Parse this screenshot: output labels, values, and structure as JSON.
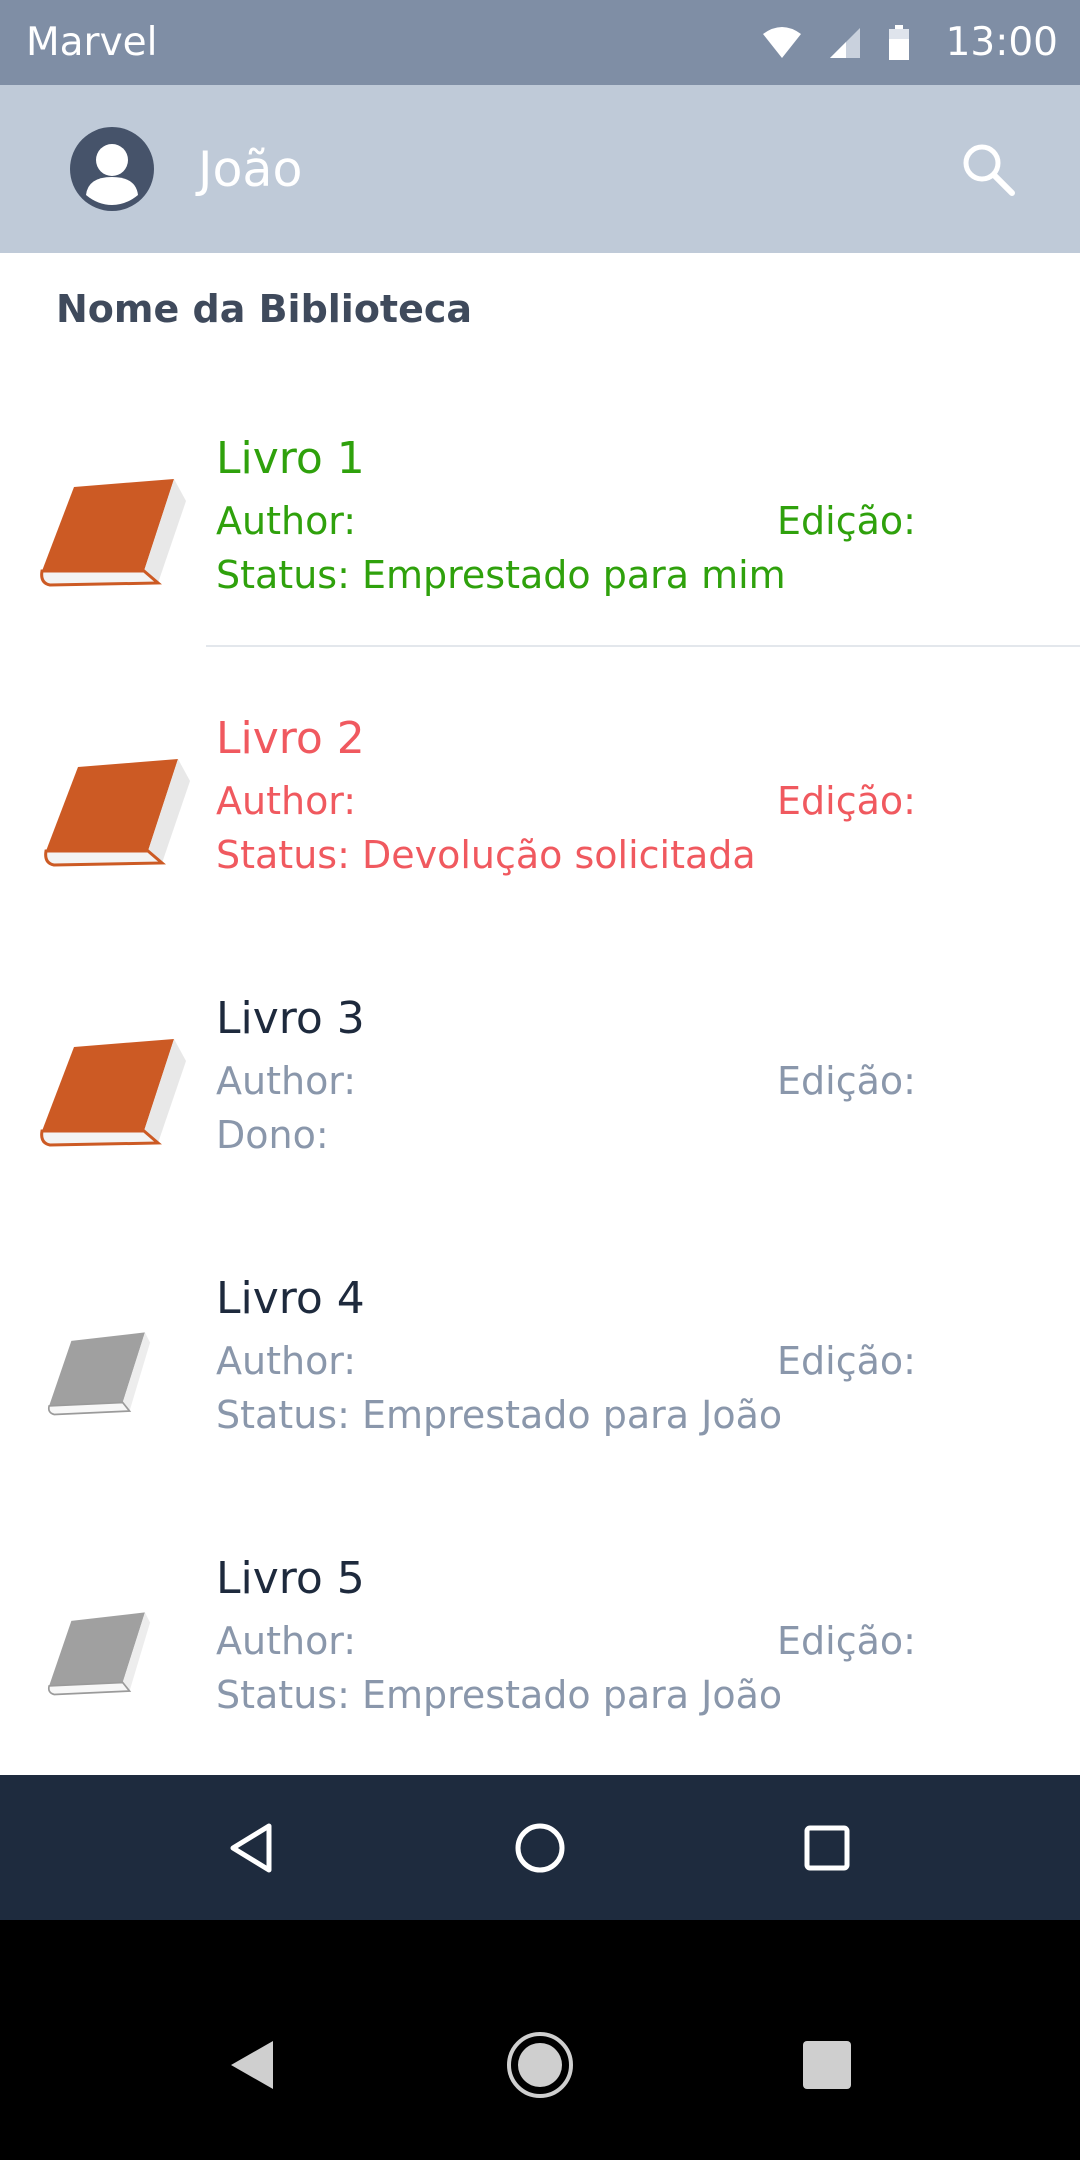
{
  "status_bar": {
    "carrier": "Marvel",
    "time": "13:00"
  },
  "app_bar": {
    "user_name": "João"
  },
  "library": {
    "title": "Nome da Biblioteca"
  },
  "books": [
    {
      "title": "Livro 1",
      "author": "Author:",
      "edition": "Edição:",
      "status": "Status: Emprestado para mim",
      "state": "green",
      "icon": "book-orange-icon"
    },
    {
      "title": "Livro 2",
      "author": "Author:",
      "edition": "Edição:",
      "status": "Status: Devolução solicitada",
      "state": "red",
      "icon": "book-orange-icon"
    },
    {
      "title": "Livro 3",
      "author": "Author:",
      "edition": "Edição:",
      "status": "Dono:",
      "state": "normal",
      "icon": "book-orange-icon"
    },
    {
      "title": "Livro 4",
      "author": "Author:",
      "edition": "Edição:",
      "status": "Status: Emprestado para João",
      "state": "normal",
      "icon": "book-gray-icon"
    },
    {
      "title": "Livro 5",
      "author": "Author:",
      "edition": "Edição:",
      "status": "Status: Emprestado para João",
      "state": "normal",
      "icon": "book-gray-icon"
    }
  ],
  "colors": {
    "status_bar": "#7f8ea5",
    "app_bar": "#bfcad8",
    "green": "#2fa10c",
    "red": "#f0595f",
    "muted": "#8a97ab",
    "nav": "#1e2b3e",
    "book_orange": "#cc5a24",
    "book_gray": "#a0a0a0"
  }
}
